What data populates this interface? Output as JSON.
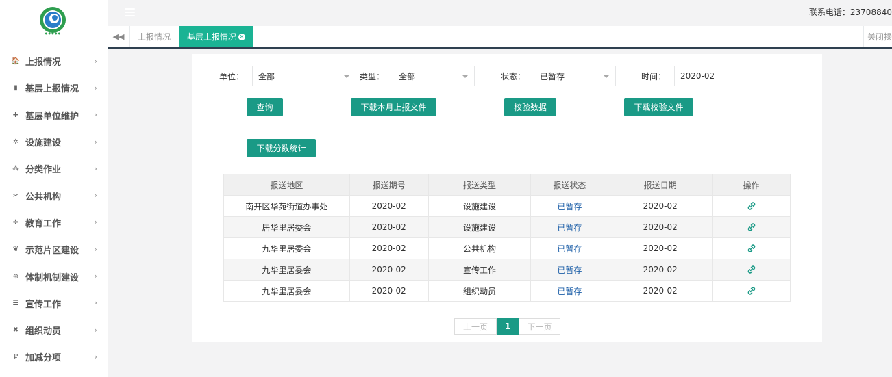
{
  "header": {
    "phone": "联系电话：23708840"
  },
  "tabs": {
    "items": [
      {
        "label": "上报情况"
      },
      {
        "label": "基层上报情况"
      }
    ],
    "close_ops": "关闭操作"
  },
  "sidebar": {
    "items": [
      {
        "label": "上报情况",
        "icon": "home-icon",
        "glyph": "🏠"
      },
      {
        "label": "基层上报情况",
        "icon": "file-icon",
        "glyph": "▮"
      },
      {
        "label": "基层单位维护",
        "icon": "plus-icon",
        "glyph": "✚"
      },
      {
        "label": "设施建设",
        "icon": "gear-icon",
        "glyph": "✲"
      },
      {
        "label": "分类作业",
        "icon": "cluster-icon",
        "glyph": "⁂"
      },
      {
        "label": "公共机构",
        "icon": "scissors-icon",
        "glyph": "✂"
      },
      {
        "label": "教育工作",
        "icon": "crosshair-icon",
        "glyph": "✜"
      },
      {
        "label": "示范片区建设",
        "icon": "leaf-icon",
        "glyph": "❦"
      },
      {
        "label": "体制机制建设",
        "icon": "lifebuoy-icon",
        "glyph": "⊛"
      },
      {
        "label": "宣传工作",
        "icon": "list-icon",
        "glyph": "☰"
      },
      {
        "label": "组织动员",
        "icon": "users-icon",
        "glyph": "✖"
      },
      {
        "label": "加减分项",
        "icon": "ruble-icon",
        "glyph": "₽"
      }
    ]
  },
  "filters": {
    "unit_label": "单位：",
    "unit_value": "全部",
    "type_label": "类型：",
    "type_value": "全部",
    "status_label": "状态：",
    "status_value": "已暂存",
    "time_label": "时间：",
    "time_value": "2020-02"
  },
  "buttons": {
    "query": "查询",
    "download_month": "下载本月上报文件",
    "verify": "校验数据",
    "download_verify": "下载校验文件",
    "download_score": "下载分数统计"
  },
  "table": {
    "headers": [
      "报送地区",
      "报送期号",
      "报送类型",
      "报送状态",
      "报送日期",
      "操作"
    ],
    "rows": [
      [
        "南开区华苑街道办事处",
        "2020-02",
        "设施建设",
        "已暂存",
        "2020-02"
      ],
      [
        "居华里居委会",
        "2020-02",
        "设施建设",
        "已暂存",
        "2020-02"
      ],
      [
        "九华里居委会",
        "2020-02",
        "公共机构",
        "已暂存",
        "2020-02"
      ],
      [
        "九华里居委会",
        "2020-02",
        "宣传工作",
        "已暂存",
        "2020-02"
      ],
      [
        "九华里居委会",
        "2020-02",
        "组织动员",
        "已暂存",
        "2020-02"
      ]
    ],
    "row_action_icon": "link-icon"
  },
  "pagination": {
    "prev": "上一页",
    "current": "1",
    "next": "下一页"
  },
  "colors": {
    "accent": "#1ab394",
    "button": "#1a9a86",
    "status_link": "#1d5fa8"
  }
}
